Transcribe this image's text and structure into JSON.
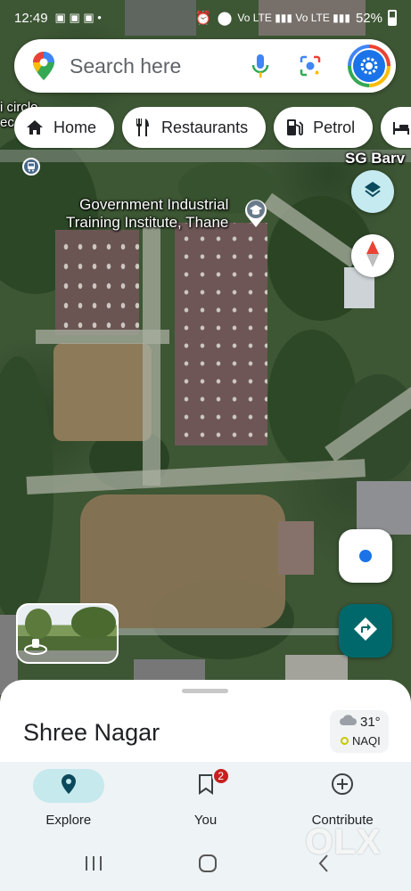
{
  "status_bar": {
    "time": "12:49",
    "battery": "52%"
  },
  "search": {
    "placeholder": "Search here"
  },
  "chips": [
    {
      "label": "Home",
      "icon": "home-icon"
    },
    {
      "label": "Restaurants",
      "icon": "fork-knife-icon"
    },
    {
      "label": "Petrol",
      "icon": "fuel-icon"
    }
  ],
  "map": {
    "poi_label_line1": "Government Industrial",
    "poi_label_line2": "Training Institute, Thane",
    "road_label": "SG Barv",
    "partial_label_line1": "i circle",
    "partial_label_line2": "ec"
  },
  "sheet": {
    "place_name": "Shree Nagar",
    "temperature": "31°",
    "aqi_label": "NAQI"
  },
  "nav": [
    {
      "label": "Explore",
      "icon": "explore-pin-icon",
      "active": true
    },
    {
      "label": "You",
      "icon": "bookmark-icon",
      "badge": "2"
    },
    {
      "label": "Contribute",
      "icon": "plus-circle-icon"
    }
  ],
  "watermark": "OLX",
  "colors": {
    "accent": "#00686b",
    "active_nav": "#c5e9ec",
    "badge": "#c5221f"
  }
}
